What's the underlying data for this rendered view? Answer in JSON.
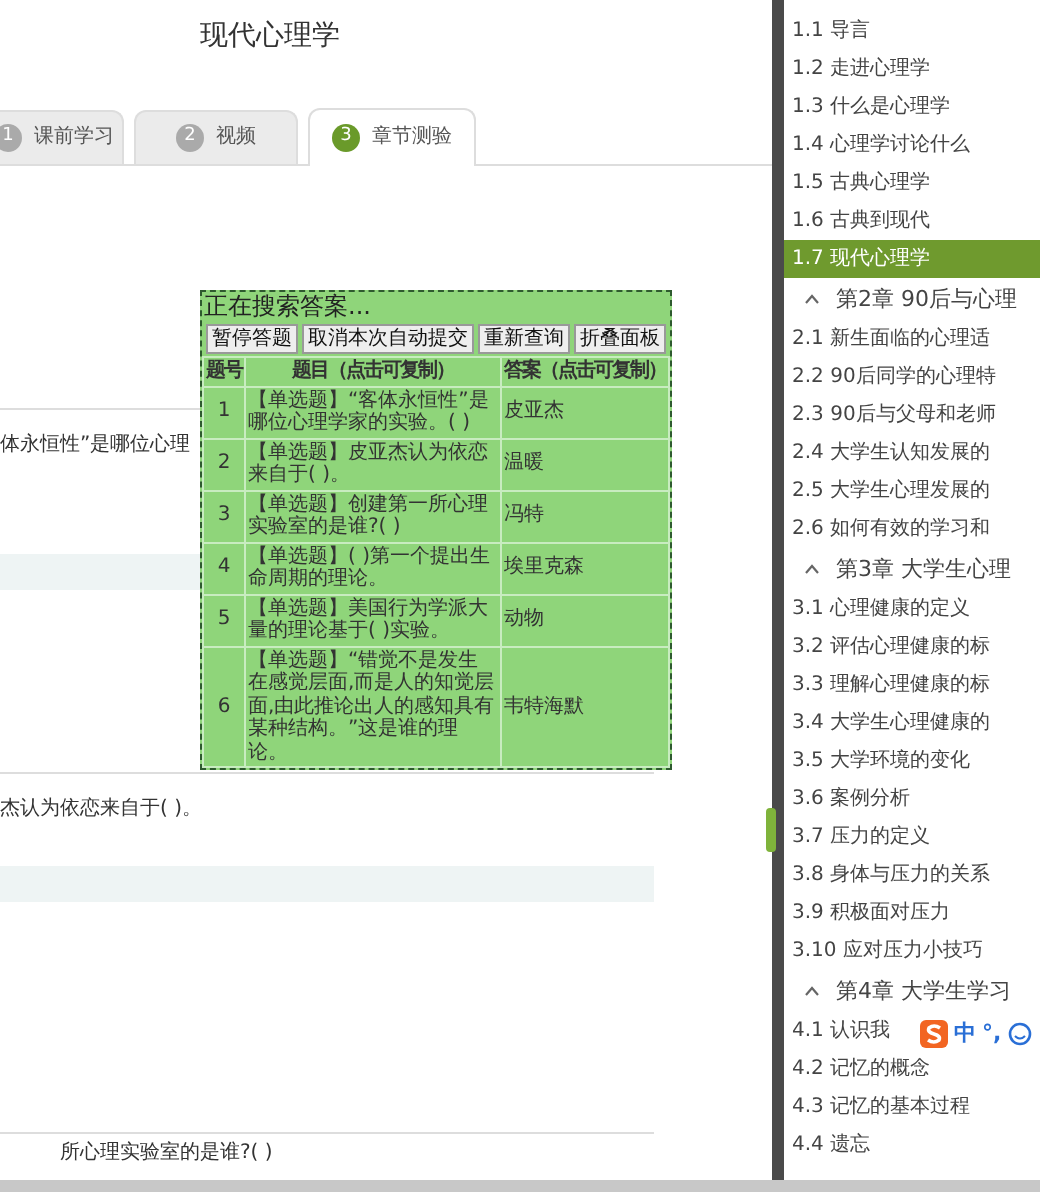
{
  "page": {
    "title": "现代心理学"
  },
  "tabs": [
    {
      "number": "1",
      "label": "课前学习",
      "selected": false
    },
    {
      "number": "2",
      "label": "视频",
      "selected": false
    },
    {
      "number": "3",
      "label": "章节测验",
      "selected": true
    }
  ],
  "questions": [
    {
      "text": "体永恒性”是哪位心理"
    },
    {
      "text": "杰认为依恋来自于( )。"
    },
    {
      "text": "所心理实验室的是谁?( )"
    }
  ],
  "answer_panel": {
    "status": "正在搜索答案...",
    "buttons": [
      "暂停答题",
      "取消本次自动提交",
      "重新查询",
      "折叠面板"
    ],
    "columns": [
      "题号",
      "题目（点击可复制）",
      "答案（点击可复制）"
    ],
    "rows": [
      {
        "number": "1",
        "question": "【单选题】“客体永恒性”是哪位心理学家的实验。( )",
        "answer": "皮亚杰"
      },
      {
        "number": "2",
        "question": "【单选题】皮亚杰认为依恋来自于( )。",
        "answer": "温暖"
      },
      {
        "number": "3",
        "question": "【单选题】创建第一所心理实验室的是谁?( )",
        "answer": "冯特"
      },
      {
        "number": "4",
        "question": "【单选题】( )第一个提出生命周期的理论。",
        "answer": "埃里克森"
      },
      {
        "number": "5",
        "question": "【单选题】美国行为学派大量的理论基于( )实验。",
        "answer": "动物"
      },
      {
        "number": "6",
        "question": "【单选题】“错觉不是发生在感觉层面,而是人的知觉层面,由此推论出人的感知具有某种结构。”这是谁的理论。",
        "answer": "韦特海默"
      }
    ]
  },
  "sidebar": {
    "items": [
      {
        "kind": "section",
        "label": "1.1 导言",
        "selected": false
      },
      {
        "kind": "section",
        "label": "1.2 走进心理学",
        "selected": false
      },
      {
        "kind": "section",
        "label": "1.3 什么是心理学",
        "selected": false
      },
      {
        "kind": "section",
        "label": "1.4 心理学讨论什么",
        "selected": false
      },
      {
        "kind": "section",
        "label": "1.5 古典心理学",
        "selected": false
      },
      {
        "kind": "section",
        "label": "1.6 古典到现代",
        "selected": false
      },
      {
        "kind": "section",
        "label": "1.7 现代心理学",
        "selected": true
      },
      {
        "kind": "chapter",
        "label": "第2章 90后与心理",
        "expanded": true
      },
      {
        "kind": "section",
        "label": "2.1 新生面临的心理适",
        "selected": false
      },
      {
        "kind": "section",
        "label": "2.2 90后同学的心理特",
        "selected": false
      },
      {
        "kind": "section",
        "label": "2.3 90后与父母和老师",
        "selected": false
      },
      {
        "kind": "section",
        "label": "2.4 大学生认知发展的",
        "selected": false
      },
      {
        "kind": "section",
        "label": "2.5 大学生心理发展的",
        "selected": false
      },
      {
        "kind": "section",
        "label": "2.6 如何有效的学习和",
        "selected": false
      },
      {
        "kind": "chapter",
        "label": "第3章 大学生心理",
        "expanded": true
      },
      {
        "kind": "section",
        "label": "3.1 心理健康的定义",
        "selected": false
      },
      {
        "kind": "section",
        "label": "3.2 评估心理健康的标",
        "selected": false
      },
      {
        "kind": "section",
        "label": "3.3 理解心理健康的标",
        "selected": false
      },
      {
        "kind": "section",
        "label": "3.4 大学生心理健康的",
        "selected": false
      },
      {
        "kind": "section",
        "label": "3.5 大学环境的变化",
        "selected": false
      },
      {
        "kind": "section",
        "label": "3.6 案例分析",
        "selected": false
      },
      {
        "kind": "section",
        "label": "3.7 压力的定义",
        "selected": false
      },
      {
        "kind": "section",
        "label": "3.8 身体与压力的关系",
        "selected": false
      },
      {
        "kind": "section",
        "label": "3.9 积极面对压力",
        "selected": false
      },
      {
        "kind": "section",
        "label": "3.10 应对压力小技巧",
        "selected": false
      },
      {
        "kind": "chapter",
        "label": "第4章 大学生学习",
        "expanded": true
      },
      {
        "kind": "section",
        "label": "4.1 认识我",
        "selected": false
      },
      {
        "kind": "section",
        "label": "4.2 记忆的概念",
        "selected": false
      },
      {
        "kind": "section",
        "label": "4.3 记忆的基本过程",
        "selected": false
      },
      {
        "kind": "section",
        "label": "4.4 遗忘",
        "selected": false
      }
    ]
  },
  "ime_toolbar": {
    "mode": "中",
    "punctuation": "°,"
  }
}
